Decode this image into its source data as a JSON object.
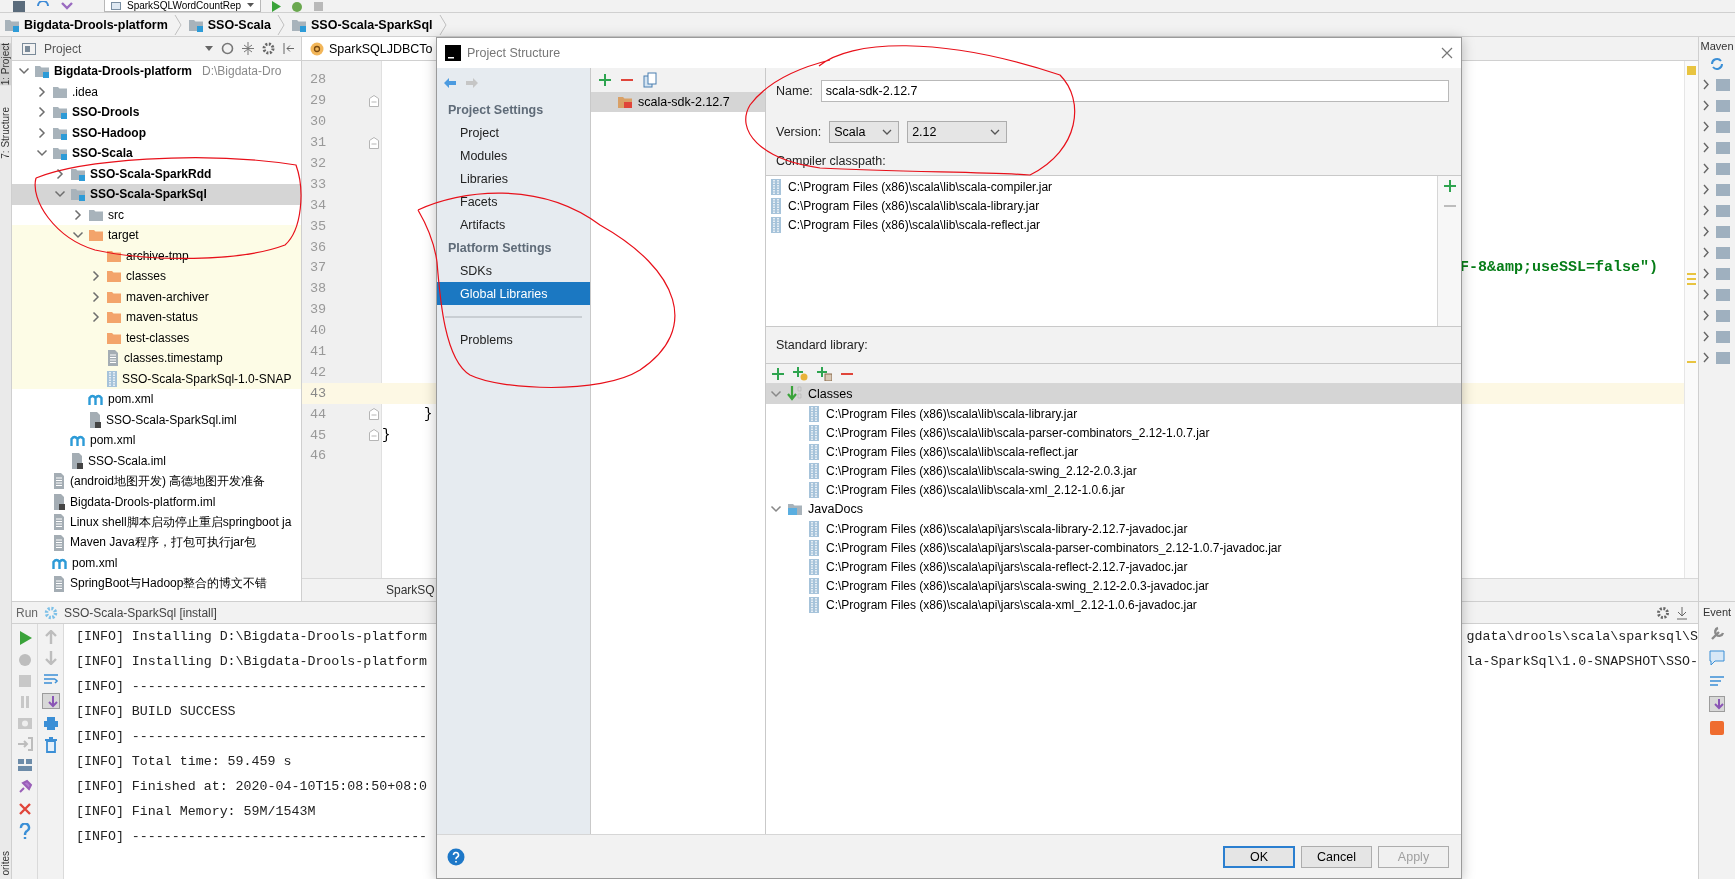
{
  "toolbar": {
    "run_config": "SparkSQLWordCountRep"
  },
  "breadcrumbs": [
    {
      "label": "Bigdata-Drools-platform"
    },
    {
      "label": "SSO-Scala"
    },
    {
      "label": "SSO-Scala-SparkSql"
    }
  ],
  "left_strip": {
    "top": [
      {
        "label": "1: Project",
        "selected": true
      },
      {
        "label": "7: Structure",
        "selected": false
      }
    ],
    "bottom": [
      {
        "label": "orites",
        "selected": false
      }
    ]
  },
  "project_panel": {
    "title": "Project",
    "tree": [
      {
        "label": "Bigdata-Drools-platform",
        "path": "D:\\Bigdata-Dro",
        "kind": "module",
        "expanded": true,
        "selected": false,
        "children": [
          {
            "label": ".idea",
            "kind": "folder",
            "expanded": false,
            "selected": false
          },
          {
            "label": "SSO-Drools",
            "kind": "module",
            "expanded": false,
            "selected": false
          },
          {
            "label": "SSO-Hadoop",
            "kind": "module",
            "expanded": false,
            "selected": false
          },
          {
            "label": "SSO-Scala",
            "kind": "module",
            "expanded": true,
            "selected": false,
            "children": [
              {
                "label": "SSO-Scala-SparkRdd",
                "kind": "module",
                "expanded": false,
                "selected": false
              },
              {
                "label": "SSO-Scala-SparkSql",
                "kind": "module",
                "expanded": true,
                "selected": true,
                "children": [
                  {
                    "label": "src",
                    "kind": "folder",
                    "expanded": false,
                    "selected": false
                  },
                  {
                    "label": "target",
                    "kind": "excluded-folder",
                    "expanded": true,
                    "excluded": true,
                    "selected": false,
                    "children": [
                      {
                        "label": "archive-tmp",
                        "kind": "excluded-folder",
                        "selected": false
                      },
                      {
                        "label": "classes",
                        "kind": "excluded-folder",
                        "expanded": false,
                        "selected": false
                      },
                      {
                        "label": "maven-archiver",
                        "kind": "excluded-folder",
                        "expanded": false,
                        "selected": false
                      },
                      {
                        "label": "maven-status",
                        "kind": "excluded-folder",
                        "expanded": false,
                        "selected": false
                      },
                      {
                        "label": "test-classes",
                        "kind": "excluded-folder",
                        "selected": false
                      },
                      {
                        "label": "classes.timestamp",
                        "kind": "file",
                        "selected": false
                      },
                      {
                        "label": "SSO-Scala-SparkSql-1.0-SNAP",
                        "kind": "jar",
                        "selected": false
                      }
                    ]
                  },
                  {
                    "label": "pom.xml",
                    "kind": "maven",
                    "selected": false
                  },
                  {
                    "label": "SSO-Scala-SparkSql.iml",
                    "kind": "iml",
                    "selected": false
                  }
                ]
              },
              {
                "label": "pom.xml",
                "kind": "maven",
                "selected": false
              },
              {
                "label": "SSO-Scala.iml",
                "kind": "iml",
                "selected": false
              }
            ]
          },
          {
            "label": "(android地图开发) 高德地图开发准备",
            "kind": "file",
            "selected": false
          },
          {
            "label": "Bigdata-Drools-platform.iml",
            "kind": "iml",
            "selected": false
          },
          {
            "label": "Linux shell脚本启动停止重启springboot ja",
            "kind": "file",
            "selected": false
          },
          {
            "label": "Maven Java程序，打包可执行jar包",
            "kind": "file",
            "selected": false
          },
          {
            "label": "pom.xml",
            "kind": "maven",
            "selected": false
          },
          {
            "label": "SpringBoot与Hadoop整合的博文不错",
            "kind": "file",
            "selected": false
          }
        ]
      }
    ]
  },
  "editor": {
    "tab": "SparkSQLJDBCTo",
    "footer": "SparkSQ",
    "lines": [
      {
        "number": "28",
        "current": false
      },
      {
        "number": "29",
        "fold": true,
        "current": false
      },
      {
        "number": "30",
        "current": false
      },
      {
        "number": "31",
        "fold": true,
        "current": false
      },
      {
        "number": "32",
        "current": false
      },
      {
        "number": "33",
        "current": false
      },
      {
        "number": "34",
        "current": false
      },
      {
        "number": "35",
        "current": false
      },
      {
        "number": "36",
        "current": false
      },
      {
        "number": "37",
        "tail": "F-8&amp;useSSL=false\")",
        "current": false
      },
      {
        "number": "38",
        "current": false
      },
      {
        "number": "39",
        "current": false
      },
      {
        "number": "40",
        "current": false
      },
      {
        "number": "41",
        "current": false
      },
      {
        "number": "42",
        "current": false
      },
      {
        "number": "43",
        "current": true
      },
      {
        "number": "44",
        "code": "     }",
        "fold": true,
        "current": false
      },
      {
        "number": "45",
        "code": "}",
        "fold": true,
        "current": false
      },
      {
        "number": "46",
        "current": false
      }
    ]
  },
  "right_strip": {
    "top": "Maven",
    "bottom": "Event"
  },
  "run_panel": {
    "label": "Run",
    "config": "SSO-Scala-SparkSql [install]",
    "lines": [
      {
        "text": "[INFO] Installing D:\\Bigdata-Drools-platform",
        "tail": "gdata\\drools\\scala\\sparksql\\S"
      },
      {
        "text": "[INFO] Installing D:\\Bigdata-Drools-platform",
        "tail": "la-SparkSql\\1.0-SNAPSHOT\\SSO-"
      },
      {
        "text": "[INFO] -------------------------------------"
      },
      {
        "text": "[INFO] BUILD SUCCESS"
      },
      {
        "text": "[INFO] -------------------------------------"
      },
      {
        "text": "[INFO] Total time: 59.459 s"
      },
      {
        "text": "[INFO] Finished at: 2020-04-10T15:08:50+08:0"
      },
      {
        "text": "[INFO] Final Memory: 59M/1543M"
      },
      {
        "text": "[INFO] -------------------------------------"
      }
    ]
  },
  "dialog": {
    "title": "Project Structure",
    "nav": [
      {
        "kind": "header",
        "label": "Project Settings"
      },
      {
        "kind": "item",
        "label": "Project",
        "selected": false
      },
      {
        "kind": "item",
        "label": "Modules",
        "selected": false
      },
      {
        "kind": "item",
        "label": "Libraries",
        "selected": false
      },
      {
        "kind": "item",
        "label": "Facets",
        "selected": false
      },
      {
        "kind": "item",
        "label": "Artifacts",
        "selected": false
      },
      {
        "kind": "header",
        "label": "Platform Settings"
      },
      {
        "kind": "item",
        "label": "SDKs",
        "selected": false
      },
      {
        "kind": "item",
        "label": "Global Libraries",
        "selected": true
      },
      {
        "kind": "separator"
      },
      {
        "kind": "item",
        "label": "Problems",
        "selected": false
      }
    ],
    "libraries": [
      {
        "label": "scala-sdk-2.12.7",
        "selected": true
      }
    ],
    "name": {
      "label": "Name:",
      "value": "scala-sdk-2.12.7"
    },
    "version": {
      "label": "Version:",
      "selects": [
        {
          "value": "Scala"
        },
        {
          "value": "2.12"
        }
      ]
    },
    "compiler_classpath": {
      "label": "Compiler classpath:",
      "entries": [
        "C:\\Program Files (x86)\\scala\\lib\\scala-compiler.jar",
        "C:\\Program Files (x86)\\scala\\lib\\scala-library.jar",
        "C:\\Program Files (x86)\\scala\\lib\\scala-reflect.jar"
      ]
    },
    "standard_library": {
      "label": "Standard library:",
      "groups": [
        {
          "label": "Classes",
          "kind": "classes",
          "expanded": true,
          "selected": true,
          "children": [
            "C:\\Program Files (x86)\\scala\\lib\\scala-library.jar",
            "C:\\Program Files (x86)\\scala\\lib\\scala-parser-combinators_2.12-1.0.7.jar",
            "C:\\Program Files (x86)\\scala\\lib\\scala-reflect.jar",
            "C:\\Program Files (x86)\\scala\\lib\\scala-swing_2.12-2.0.3.jar",
            "C:\\Program Files (x86)\\scala\\lib\\scala-xml_2.12-1.0.6.jar"
          ]
        },
        {
          "label": "JavaDocs",
          "kind": "javadocs",
          "expanded": true,
          "selected": false,
          "children": [
            "C:\\Program Files (x86)\\scala\\api\\jars\\scala-library-2.12.7-javadoc.jar",
            "C:\\Program Files (x86)\\scala\\api\\jars\\scala-parser-combinators_2.12-1.0.7-javadoc.jar",
            "C:\\Program Files (x86)\\scala\\api\\jars\\scala-reflect-2.12.7-javadoc.jar",
            "C:\\Program Files (x86)\\scala\\api\\jars\\scala-swing_2.12-2.0.3-javadoc.jar",
            "C:\\Program Files (x86)\\scala\\api\\jars\\scala-xml_2.12-1.0.6-javadoc.jar"
          ]
        }
      ]
    },
    "buttons": [
      {
        "label": "OK",
        "kind": "primary",
        "disabled": false
      },
      {
        "label": "Cancel",
        "kind": "normal",
        "disabled": false
      },
      {
        "label": "Apply",
        "kind": "normal",
        "disabled": true
      }
    ]
  }
}
